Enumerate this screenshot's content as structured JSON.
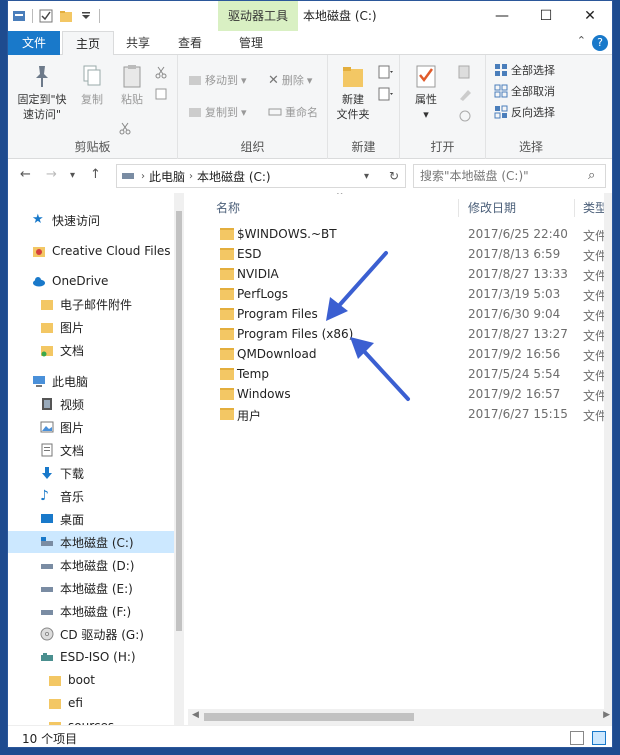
{
  "window": {
    "title": "本地磁盘 (C:)",
    "context_tab": "驱动器工具",
    "controls": {
      "minimize": "—",
      "maximize": "☐",
      "close": "✕"
    }
  },
  "tabs": [
    {
      "label": "文件"
    },
    {
      "label": "主页"
    },
    {
      "label": "共享"
    },
    {
      "label": "查看"
    },
    {
      "label": "管理"
    }
  ],
  "ribbon": {
    "clipboard": {
      "label": "剪贴板",
      "pin_line1": "固定到\"快",
      "pin_line2": "速访问\"",
      "copy": "复制",
      "paste": "粘贴"
    },
    "organize": {
      "label": "组织",
      "move_to": "移动到",
      "copy_to": "复制到",
      "delete": "删除",
      "rename": "重命名"
    },
    "new": {
      "label": "新建",
      "new_folder_line1": "新建",
      "new_folder_line2": "文件夹"
    },
    "open": {
      "label": "打开",
      "properties": "属性"
    },
    "select": {
      "label": "选择",
      "select_all": "全部选择",
      "select_none": "全部取消",
      "invert": "反向选择"
    }
  },
  "address": {
    "crumbs": [
      "此电脑",
      "本地磁盘 (C:)"
    ],
    "search_placeholder": "搜索\"本地磁盘 (C:)\""
  },
  "nav": [
    {
      "label": "快速访问",
      "icon": "star-icon"
    },
    {
      "label": "Creative Cloud Files",
      "icon": "cc-icon"
    },
    {
      "label": "OneDrive",
      "icon": "cloud-icon"
    },
    {
      "label": "电子邮件附件",
      "icon": "folder-icon"
    },
    {
      "label": "图片",
      "icon": "folder-icon"
    },
    {
      "label": "文档",
      "icon": "folder-icon"
    },
    {
      "label": "此电脑",
      "icon": "computer-icon"
    },
    {
      "label": "视频",
      "icon": "video-icon"
    },
    {
      "label": "图片",
      "icon": "pictures-icon"
    },
    {
      "label": "文档",
      "icon": "documents-icon"
    },
    {
      "label": "下载",
      "icon": "download-icon"
    },
    {
      "label": "音乐",
      "icon": "music-icon"
    },
    {
      "label": "桌面",
      "icon": "desktop-icon"
    },
    {
      "label": "本地磁盘 (C:)",
      "icon": "drive-icon"
    },
    {
      "label": "本地磁盘 (D:)",
      "icon": "drive-icon"
    },
    {
      "label": "本地磁盘 (E:)",
      "icon": "drive-icon"
    },
    {
      "label": "本地磁盘 (F:)",
      "icon": "drive-icon"
    },
    {
      "label": "CD 驱动器 (G:)",
      "icon": "cd-icon"
    },
    {
      "label": "ESD-ISO (H:)",
      "icon": "usb-icon"
    },
    {
      "label": "boot",
      "icon": "folder-icon"
    },
    {
      "label": "efi",
      "icon": "folder-icon"
    },
    {
      "label": "sources",
      "icon": "folder-icon"
    }
  ],
  "columns": {
    "name": "名称",
    "date": "修改日期",
    "type": "类型"
  },
  "files": [
    {
      "name": "$WINDOWS.~BT",
      "date": "2017/6/25 22:40",
      "type": "文件夹"
    },
    {
      "name": "ESD",
      "date": "2017/8/13 6:59",
      "type": "文件夹"
    },
    {
      "name": "NVIDIA",
      "date": "2017/8/27 13:33",
      "type": "文件夹"
    },
    {
      "name": "PerfLogs",
      "date": "2017/3/19 5:03",
      "type": "文件夹"
    },
    {
      "name": "Program Files",
      "date": "2017/6/30 9:04",
      "type": "文件夹"
    },
    {
      "name": "Program Files (x86)",
      "date": "2017/8/27 13:27",
      "type": "文件夹"
    },
    {
      "name": "QMDownload",
      "date": "2017/9/2 16:56",
      "type": "文件夹"
    },
    {
      "name": "Temp",
      "date": "2017/5/24 5:54",
      "type": "文件夹"
    },
    {
      "name": "Windows",
      "date": "2017/9/2 16:57",
      "type": "文件夹"
    },
    {
      "name": "用户",
      "date": "2017/6/27 15:15",
      "type": "文件夹"
    }
  ],
  "status": {
    "count": "10 个项目"
  },
  "colors": {
    "accent": "#1979ca",
    "selection": "#cce8ff",
    "annotation_arrow": "#3b5fd1"
  }
}
